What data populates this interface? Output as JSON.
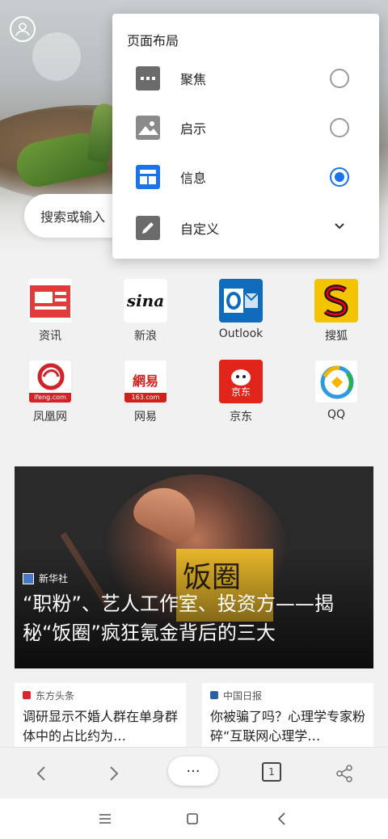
{
  "popup": {
    "title": "页面布局",
    "options": [
      {
        "label": "聚焦",
        "icon": "focus-layout-icon",
        "selected": false,
        "kind": "radio"
      },
      {
        "label": "启示",
        "icon": "image-layout-icon",
        "selected": false,
        "kind": "radio"
      },
      {
        "label": "信息",
        "icon": "info-layout-icon",
        "selected": true,
        "kind": "radio"
      },
      {
        "label": "自定义",
        "icon": "edit-pencil-icon",
        "selected": false,
        "kind": "expand"
      }
    ]
  },
  "search": {
    "placeholder": "搜索或输入"
  },
  "shortcuts": [
    {
      "label": "资讯",
      "icon": "news-icon"
    },
    {
      "label": "新浪",
      "icon": "sina-icon",
      "logo": "sina"
    },
    {
      "label": "Outlook",
      "icon": "outlook-icon"
    },
    {
      "label": "搜狐",
      "icon": "sohu-icon"
    },
    {
      "label": "凤凰网",
      "icon": "ifeng-icon",
      "logo": "ifeng.com"
    },
    {
      "label": "网易",
      "icon": "netease-icon",
      "logo": "網易",
      "logo_sub": "163.com"
    },
    {
      "label": "京东",
      "icon": "jd-icon",
      "logo": "京东"
    },
    {
      "label": "QQ",
      "icon": "qq-icon"
    }
  ],
  "feature_news": {
    "source": "新华社",
    "title": "“职粉”、艺人工作室、投资方——揭秘“饭圈”疯狂氪金背后的三大",
    "image_text": "饭圈"
  },
  "news": [
    {
      "source": "东方头条",
      "title": "调研显示不婚人群在单身群体中的占比约为…"
    },
    {
      "source": "中国日报",
      "title": "你被骗了吗？心理学专家粉碎“互联网心理学…"
    }
  ],
  "toolbar": {
    "menu": "···",
    "tab_count": "1"
  },
  "colors": {
    "accent": "#1a73e8",
    "background": "#f1f1f1"
  }
}
